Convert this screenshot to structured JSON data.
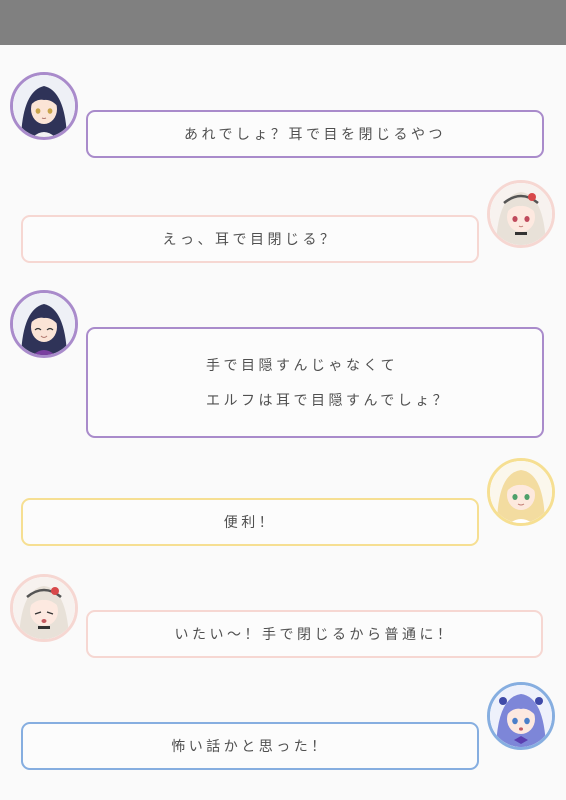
{
  "colors": {
    "topbar": "#808080",
    "purple": "#a98bcb",
    "pink": "#f6d7d2",
    "yellow": "#f6df92",
    "blue": "#86aee0"
  },
  "messages": [
    {
      "speaker": "dark-haired-girl",
      "icon": "dark-haired-girl-avatar-icon",
      "lines": [
        "あれでしょ？耳で目を閉じるやつ"
      ]
    },
    {
      "speaker": "silver-haired-girl",
      "icon": "silver-haired-girl-avatar-icon",
      "lines": [
        "えっ、耳で目閉じる？"
      ]
    },
    {
      "speaker": "dark-haired-girl",
      "icon": "dark-haired-girl-smiling-avatar-icon",
      "lines": [
        "手で目隠すんじゃなくて",
        "エルフは耳で目隠すんでしょ？"
      ]
    },
    {
      "speaker": "blonde-girl",
      "icon": "blonde-girl-avatar-icon",
      "lines": [
        "便利！"
      ]
    },
    {
      "speaker": "silver-haired-girl",
      "icon": "silver-haired-girl-avatar-icon",
      "lines": [
        "いたい～！手で閉じるから普通に！"
      ]
    },
    {
      "speaker": "blue-haired-girl",
      "icon": "blue-haired-girl-avatar-icon",
      "lines": [
        "怖い話かと思った！"
      ]
    }
  ]
}
